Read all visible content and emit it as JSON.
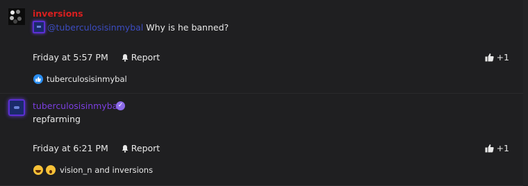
{
  "posts": [
    {
      "username": "inversions",
      "mention": "@tuberculosisinmybal",
      "message": "Why is he banned?",
      "timestamp": "Friday at 5:57 PM",
      "report_label": "Report",
      "like_count": "+1",
      "reactors": "tuberculosisinmybal"
    },
    {
      "username": "tuberculosisinmybal",
      "message": "repfarming",
      "timestamp": "Friday at 6:21 PM",
      "report_label": "Report",
      "like_count": "+1",
      "reactors": "vision_n and inversions"
    }
  ],
  "colors": {
    "background": "#1f1f21",
    "username_banned": "#d81f1f",
    "username_member": "#7b3fe0",
    "mention": "#3c4cc0",
    "like_reaction": "#2a8df0"
  }
}
